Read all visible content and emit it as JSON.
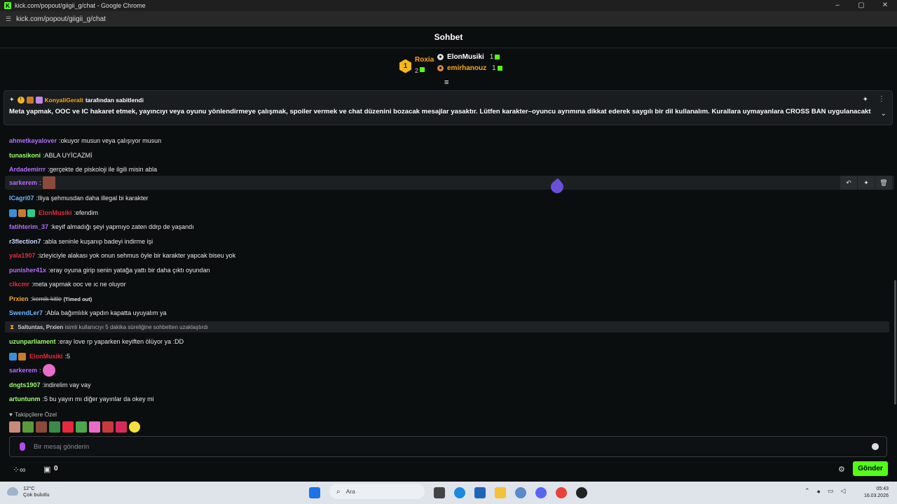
{
  "window": {
    "title": "kick.com/popout/giigii_g/chat - Google Chrome",
    "url": "kick.com/popout/giigii_g/chat",
    "controls": [
      "–",
      "▢",
      "✕"
    ]
  },
  "chat": {
    "title": "Sohbet"
  },
  "leaderboard": {
    "first": {
      "rank": "1",
      "name": "Roxia",
      "count": "2"
    },
    "others": [
      {
        "name": "ElonMusiki",
        "count": "1",
        "color": "#ffffff"
      },
      {
        "name": "emirhanouz",
        "count": "1",
        "color": "#f5a623"
      }
    ]
  },
  "pinned": {
    "author": "KonyaliGeralt",
    "suffix": "tarafından sabitlendi",
    "message": "Meta yapmak, OOC ve IC hakaret etmek, yayıncıyı veya oyunu yönlendirmeye çalışmak, spoiler vermek ve chat düzenini bozacak mesajlar yasaktır. Lütfen karakter–oyuncu ayrımına dikkat ederek saygılı bir dil kullanalım. Kurallara uymayanlara CROSS BAN uygulanacaktır."
  },
  "messages": [
    {
      "user": "ahmetkayalover",
      "color": "#b46cff",
      "text": "okuyor musun veya çalışıyor musun"
    },
    {
      "user": "tunasikoni",
      "color": "#9dff6c",
      "text": "ABLA UYİCAZMİ"
    },
    {
      "user": "Ardademirrr",
      "color": "#b46cff",
      "text": "gerçekte de piskoloji ile ilgili misin abla"
    },
    {
      "user": "sarkerem",
      "color": "#b46cff",
      "text": ""
    },
    {
      "user": "ICagri07",
      "color": "#6cb4ff",
      "text": "Iliya şehmusdan daha illegal bi karakter"
    },
    {
      "user": "ElonMusiki",
      "color": "#e8283f",
      "text": "efendim"
    },
    {
      "user": "fatihterim_37",
      "color": "#b46cff",
      "text": "keyif almadığı şeyi yapmıyo zaten ddrp de yaşandı"
    },
    {
      "user": "r3flection7",
      "color": "#cfd8ff",
      "text": "abla seninle kuşanıp badeyi indirme işi"
    },
    {
      "user": "yala1907",
      "color": "#e8283f",
      "text": "izleyiciyle alakası yok onun sehmus öyle bir karakter yapcak biseu yok"
    },
    {
      "user": "punisher41x",
      "color": "#b46cff",
      "text": "eray oyuna girip senin yatağa yattı bir daha çıktı oyundan"
    },
    {
      "user": "clkcmr",
      "color": "#e8283f",
      "text": "meta yapmak ooc ve ıc ne oluyor"
    },
    {
      "user": "Prxien",
      "color": "#f5a623",
      "text": "kemik kitle",
      "note": "(Timed out)"
    },
    {
      "user": "SwendLer7",
      "color": "#6cb4ff",
      "text": "Abla bağımlılık yapdın kapatta uyuyalım ya"
    },
    {
      "user": "uzunparliament",
      "color": "#9dff6c",
      "text": "eray love rp yaparken keyiften ölüyor ya :DD"
    },
    {
      "user": "ElonMusiki",
      "color": "#e8283f",
      "text": "5"
    },
    {
      "user": "sarkerem",
      "color": "#b46cff",
      "text": ""
    },
    {
      "user": "dngts1907",
      "color": "#9dff6c",
      "text": "indirelim vay vay"
    },
    {
      "user": "artuntunm",
      "color": "#9dff6c",
      "text": "5 bu yayın mı diğer yayınlar da okey mi"
    }
  ],
  "timeout_notice": {
    "actors": "Saltuntas, Prxien",
    "text": "isimli kullanıcıyı 5 dakika süreliğine sohbetten uzaklaştırdı"
  },
  "follower_only": {
    "label": "Takipçilere Özel"
  },
  "input": {
    "placeholder": "Bir mesaj gönderin"
  },
  "footer": {
    "count": "0",
    "send": "Gönder"
  },
  "taskbar": {
    "temp": "12°C",
    "weather": "Çok bulutlu",
    "search": "Ara",
    "time": "05:43",
    "date": "16.03.2026"
  }
}
